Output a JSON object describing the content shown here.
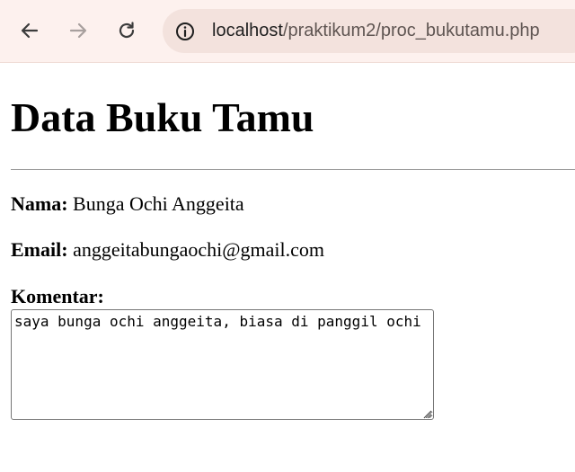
{
  "browser": {
    "url_host": "localhost",
    "url_path": "/praktikum2/proc_bukutamu.php"
  },
  "page": {
    "title": "Data Buku Tamu",
    "nama_label": "Nama:",
    "nama_value": "Bunga Ochi Anggeita",
    "email_label": "Email:",
    "email_value": "anggeitabungaochi@gmail.com",
    "komentar_label": "Komentar:",
    "komentar_value": "saya bunga ochi anggeita, biasa di panggil ochi"
  },
  "icons": {
    "back": "arrow-left-icon",
    "forward": "arrow-right-icon",
    "reload": "reload-icon",
    "site_info": "info-icon"
  }
}
